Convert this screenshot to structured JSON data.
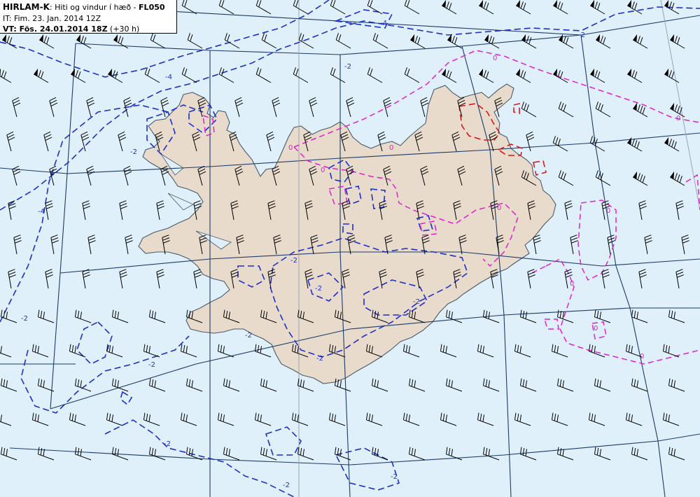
{
  "header": {
    "model": "HIRLAM-K",
    "description": ": Hiti og vindur í hæð - ",
    "level": "FL050",
    "it_label": "IT:",
    "it_value": " Fim. 23. Jan. 2014 12Z",
    "vt_label": "VT:",
    "vt_value": " Fös. 24.01.2014 18Z",
    "vt_offset": " (+30 h)"
  },
  "contour_labels": {
    "neg4": "-4",
    "neg2": "-2",
    "zero": "0"
  },
  "colors": {
    "sea": "#dff0fb",
    "land": "#e8dbcc",
    "coast": "#4a5a6a",
    "grid": "#1a3a6a",
    "meridian": "#9aa4b0",
    "contour_neg": "#1d2fc8",
    "contour_zero": "#e020d0",
    "contour_pos": "#d81818",
    "barb": "#000000"
  }
}
